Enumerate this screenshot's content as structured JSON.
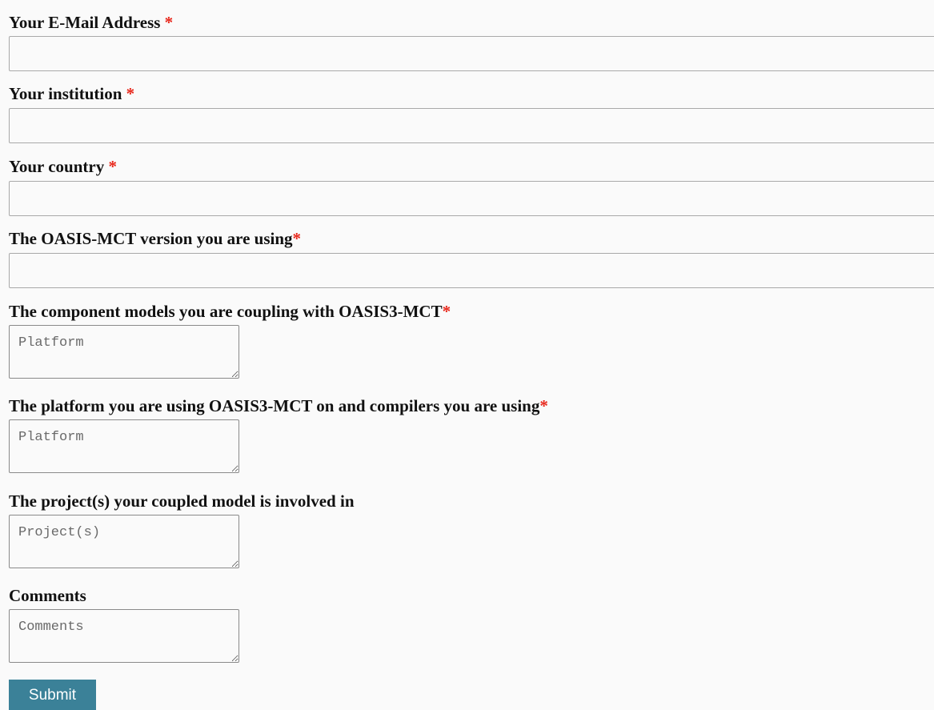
{
  "form": {
    "required_marker": "*",
    "fields": [
      {
        "label": "Your E-Mail Address",
        "required_marker": " *",
        "value": ""
      },
      {
        "label": "Your institution",
        "required_marker": " *",
        "value": ""
      },
      {
        "label": "Your country",
        "required_marker": " *",
        "value": ""
      },
      {
        "label": "The OASIS-MCT version you are using",
        "required_marker": "*",
        "value": ""
      }
    ],
    "textareas": [
      {
        "label": "The component models you are coupling with OASIS3-MCT",
        "required_marker": "*",
        "placeholder": "Platform"
      },
      {
        "label": "The platform you are using OASIS3-MCT on and compilers you are using",
        "required_marker": "*",
        "placeholder": "Platform"
      },
      {
        "label": "The project(s) your coupled model is involved in",
        "required_marker": "",
        "placeholder": "Project(s)"
      },
      {
        "label": "Comments",
        "required_marker": "",
        "placeholder": "Comments"
      }
    ],
    "submit_label": "Submit"
  },
  "colors": {
    "required": "#e8281c",
    "button": "#3b8198",
    "background": "#fafafa"
  }
}
